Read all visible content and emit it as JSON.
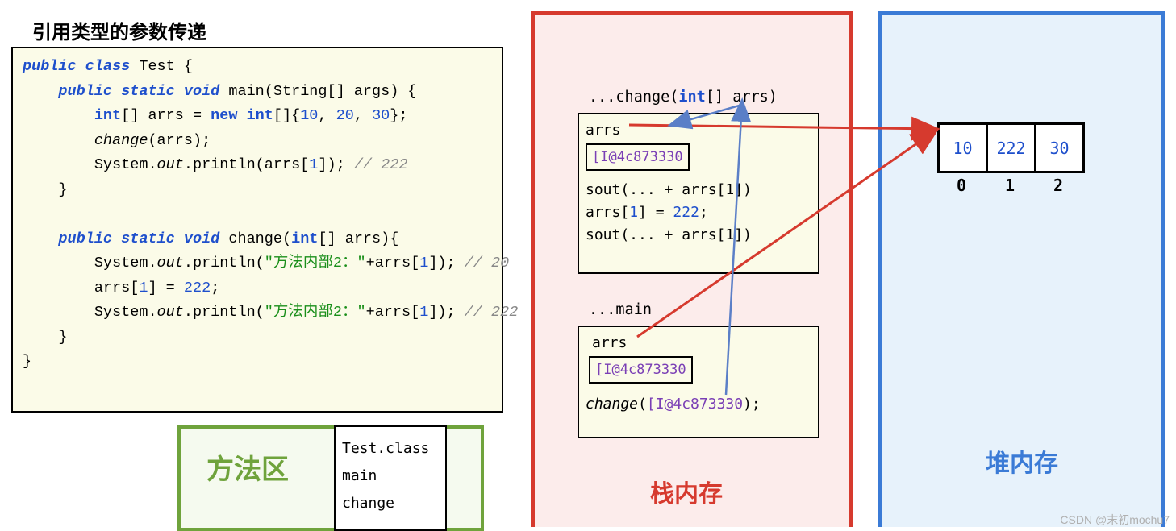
{
  "title": "引用类型的参数传递",
  "code": {
    "l1a": "public class",
    "l1b": " Test {",
    "l2a": "public static void",
    "l2b": " main",
    "l2c": "(String[] args) {",
    "l3a": "int",
    "l3b": "[] arrs = ",
    "l3c": "new int",
    "l3d": "[]{",
    "l3e": "10",
    "l3f": ", ",
    "l3g": "20",
    "l3h": ", ",
    "l3i": "30",
    "l3j": "};",
    "l4a": "change",
    "l4b": "(arrs);",
    "l5a": "System.",
    "l5b": "out",
    "l5c": ".println(arrs[",
    "l5d": "1",
    "l5e": "]); ",
    "l5f": "// 222",
    "l6": "}",
    "l7a": "public static void",
    "l7b": " change",
    "l7c": "(",
    "l7d": "int",
    "l7e": "[] arrs){",
    "l8a": "System.",
    "l8b": "out",
    "l8c": ".println(",
    "l8d": "\"方法内部2：\"",
    "l8e": "+arrs[",
    "l8f": "1",
    "l8g": "]); ",
    "l8h": "// 20",
    "l9a": "arrs[",
    "l9b": "1",
    "l9c": "] = ",
    "l9d": "222",
    "l9e": ";",
    "l10a": "System.",
    "l10b": "out",
    "l10c": ".println(",
    "l10d": "\"方法内部2：\"",
    "l10e": "+arrs[",
    "l10f": "1",
    "l10g": "]); ",
    "l10h": "// 222",
    "l11": "}",
    "l12": "}"
  },
  "method_area": {
    "label": "方法区",
    "file": "Test.class",
    "m1": "main",
    "m2": "change"
  },
  "stack": {
    "label": "栈内存",
    "change_title_a": "...change(",
    "change_title_b": "int",
    "change_title_c": "[] arrs)",
    "change_arrs": "arrs",
    "change_addr": "[I@4c873330",
    "change_l1": "sout(... + arrs[1])",
    "change_l2a": "arrs[",
    "change_l2b": "1",
    "change_l2c": "] = ",
    "change_l2d": "222",
    "change_l2e": ";",
    "change_l3": "sout(... + arrs[1])",
    "main_title": "...main",
    "main_arrs": "arrs",
    "main_addr": "[I@4c873330",
    "main_call_a": "change",
    "main_call_b": "(",
    "main_call_c": "[I@4c873330",
    "main_call_d": ");"
  },
  "heap": {
    "label": "堆内存",
    "cells": [
      "10",
      "222",
      "30"
    ],
    "idx": [
      "0",
      "1",
      "2"
    ]
  },
  "watermark": "CSDN @末初mochu7"
}
